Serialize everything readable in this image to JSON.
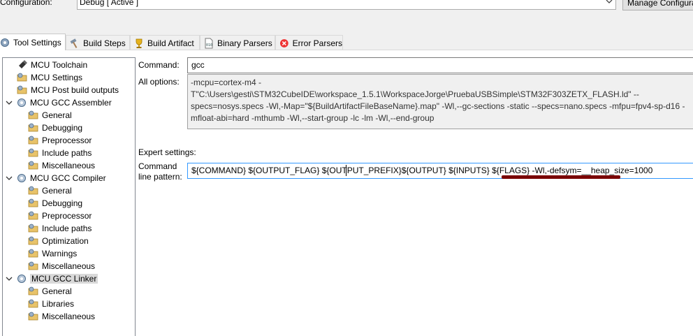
{
  "config": {
    "label": "Configuration:",
    "value": "Debug  [ Active ]",
    "manage_label": "Manage Configura"
  },
  "tabs": [
    {
      "label": "Tool Settings",
      "icon": "gear-icon",
      "active": true
    },
    {
      "label": "Build Steps",
      "icon": "hammer-icon",
      "active": false
    },
    {
      "label": "Build Artifact",
      "icon": "trophy-icon",
      "active": false
    },
    {
      "label": "Binary Parsers",
      "icon": "binary-icon",
      "active": false
    },
    {
      "label": "Error Parsers",
      "icon": "error-icon",
      "active": false
    }
  ],
  "tree": [
    {
      "label": "MCU Toolchain",
      "level": 0,
      "icon": "toolchain-icon"
    },
    {
      "label": "MCU Settings",
      "level": 0,
      "icon": "folder-settings-icon"
    },
    {
      "label": "MCU Post build outputs",
      "level": 0,
      "icon": "folder-settings-icon"
    },
    {
      "label": "MCU GCC Assembler",
      "level": 0,
      "icon": "gear-icon",
      "expanded": true
    },
    {
      "label": "General",
      "level": 1,
      "icon": "folder-settings-icon"
    },
    {
      "label": "Debugging",
      "level": 1,
      "icon": "folder-settings-icon"
    },
    {
      "label": "Preprocessor",
      "level": 1,
      "icon": "folder-settings-icon"
    },
    {
      "label": "Include paths",
      "level": 1,
      "icon": "folder-settings-icon"
    },
    {
      "label": "Miscellaneous",
      "level": 1,
      "icon": "folder-settings-icon"
    },
    {
      "label": "MCU GCC Compiler",
      "level": 0,
      "icon": "gear-icon",
      "expanded": true
    },
    {
      "label": "General",
      "level": 1,
      "icon": "folder-settings-icon"
    },
    {
      "label": "Debugging",
      "level": 1,
      "icon": "folder-settings-icon"
    },
    {
      "label": "Preprocessor",
      "level": 1,
      "icon": "folder-settings-icon"
    },
    {
      "label": "Include paths",
      "level": 1,
      "icon": "folder-settings-icon"
    },
    {
      "label": "Optimization",
      "level": 1,
      "icon": "folder-settings-icon"
    },
    {
      "label": "Warnings",
      "level": 1,
      "icon": "folder-settings-icon"
    },
    {
      "label": "Miscellaneous",
      "level": 1,
      "icon": "folder-settings-icon"
    },
    {
      "label": "MCU GCC Linker",
      "level": 0,
      "icon": "gear-icon",
      "expanded": true,
      "selected": true
    },
    {
      "label": "General",
      "level": 1,
      "icon": "folder-settings-icon"
    },
    {
      "label": "Libraries",
      "level": 1,
      "icon": "folder-settings-icon"
    },
    {
      "label": "Miscellaneous",
      "level": 1,
      "icon": "folder-settings-icon"
    }
  ],
  "panel": {
    "command_label": "Command:",
    "command_value": "gcc",
    "all_options_label": "All options:",
    "all_options_value": "-mcpu=cortex-m4 -T\"C:\\Users\\gesti\\STM32CubeIDE\\workspace_1.5.1\\WorkspaceJorge\\PruebaUSBSimple\\STM32F303ZETX_FLASH.ld\" --specs=nosys.specs -Wl,-Map=\"${BuildArtifactFileBaseName}.map\" -Wl,--gc-sections -static --specs=nano.specs -mfpu=fpv4-sp-d16 -mfloat-abi=hard -mthumb -Wl,--start-group -lc -lm -Wl,--end-group",
    "expert_label": "Expert settings:",
    "cmdline_label_1": "Command",
    "cmdline_label_2": "line pattern:",
    "cmdline_value": "${COMMAND} ${OUTPUT_FLAG} ${OUTPUT_PREFIX}${OUTPUT} ${INPUTS} ${FLAGS} -Wl,-defsym=__heap_size=1000"
  },
  "colors": {
    "selection": "#d9d9d9",
    "focus_border": "#3399ff",
    "annotation_underline": "#7a0000"
  }
}
